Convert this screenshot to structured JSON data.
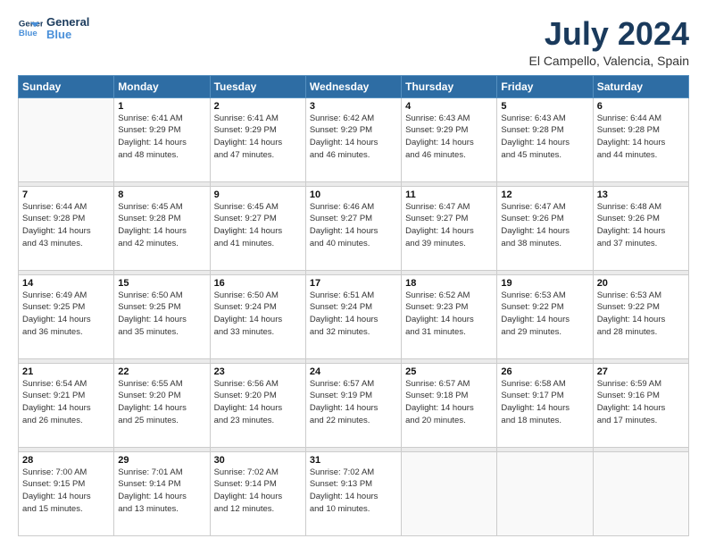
{
  "logo": {
    "line1": "General",
    "line2": "Blue"
  },
  "title": "July 2024",
  "subtitle": "El Campello, Valencia, Spain",
  "days_header": [
    "Sunday",
    "Monday",
    "Tuesday",
    "Wednesday",
    "Thursday",
    "Friday",
    "Saturday"
  ],
  "weeks": [
    [
      {
        "day": "",
        "text": ""
      },
      {
        "day": "1",
        "text": "Sunrise: 6:41 AM\nSunset: 9:29 PM\nDaylight: 14 hours\nand 48 minutes."
      },
      {
        "day": "2",
        "text": "Sunrise: 6:41 AM\nSunset: 9:29 PM\nDaylight: 14 hours\nand 47 minutes."
      },
      {
        "day": "3",
        "text": "Sunrise: 6:42 AM\nSunset: 9:29 PM\nDaylight: 14 hours\nand 46 minutes."
      },
      {
        "day": "4",
        "text": "Sunrise: 6:43 AM\nSunset: 9:29 PM\nDaylight: 14 hours\nand 46 minutes."
      },
      {
        "day": "5",
        "text": "Sunrise: 6:43 AM\nSunset: 9:28 PM\nDaylight: 14 hours\nand 45 minutes."
      },
      {
        "day": "6",
        "text": "Sunrise: 6:44 AM\nSunset: 9:28 PM\nDaylight: 14 hours\nand 44 minutes."
      }
    ],
    [
      {
        "day": "7",
        "text": "Sunrise: 6:44 AM\nSunset: 9:28 PM\nDaylight: 14 hours\nand 43 minutes."
      },
      {
        "day": "8",
        "text": "Sunrise: 6:45 AM\nSunset: 9:28 PM\nDaylight: 14 hours\nand 42 minutes."
      },
      {
        "day": "9",
        "text": "Sunrise: 6:45 AM\nSunset: 9:27 PM\nDaylight: 14 hours\nand 41 minutes."
      },
      {
        "day": "10",
        "text": "Sunrise: 6:46 AM\nSunset: 9:27 PM\nDaylight: 14 hours\nand 40 minutes."
      },
      {
        "day": "11",
        "text": "Sunrise: 6:47 AM\nSunset: 9:27 PM\nDaylight: 14 hours\nand 39 minutes."
      },
      {
        "day": "12",
        "text": "Sunrise: 6:47 AM\nSunset: 9:26 PM\nDaylight: 14 hours\nand 38 minutes."
      },
      {
        "day": "13",
        "text": "Sunrise: 6:48 AM\nSunset: 9:26 PM\nDaylight: 14 hours\nand 37 minutes."
      }
    ],
    [
      {
        "day": "14",
        "text": "Sunrise: 6:49 AM\nSunset: 9:25 PM\nDaylight: 14 hours\nand 36 minutes."
      },
      {
        "day": "15",
        "text": "Sunrise: 6:50 AM\nSunset: 9:25 PM\nDaylight: 14 hours\nand 35 minutes."
      },
      {
        "day": "16",
        "text": "Sunrise: 6:50 AM\nSunset: 9:24 PM\nDaylight: 14 hours\nand 33 minutes."
      },
      {
        "day": "17",
        "text": "Sunrise: 6:51 AM\nSunset: 9:24 PM\nDaylight: 14 hours\nand 32 minutes."
      },
      {
        "day": "18",
        "text": "Sunrise: 6:52 AM\nSunset: 9:23 PM\nDaylight: 14 hours\nand 31 minutes."
      },
      {
        "day": "19",
        "text": "Sunrise: 6:53 AM\nSunset: 9:22 PM\nDaylight: 14 hours\nand 29 minutes."
      },
      {
        "day": "20",
        "text": "Sunrise: 6:53 AM\nSunset: 9:22 PM\nDaylight: 14 hours\nand 28 minutes."
      }
    ],
    [
      {
        "day": "21",
        "text": "Sunrise: 6:54 AM\nSunset: 9:21 PM\nDaylight: 14 hours\nand 26 minutes."
      },
      {
        "day": "22",
        "text": "Sunrise: 6:55 AM\nSunset: 9:20 PM\nDaylight: 14 hours\nand 25 minutes."
      },
      {
        "day": "23",
        "text": "Sunrise: 6:56 AM\nSunset: 9:20 PM\nDaylight: 14 hours\nand 23 minutes."
      },
      {
        "day": "24",
        "text": "Sunrise: 6:57 AM\nSunset: 9:19 PM\nDaylight: 14 hours\nand 22 minutes."
      },
      {
        "day": "25",
        "text": "Sunrise: 6:57 AM\nSunset: 9:18 PM\nDaylight: 14 hours\nand 20 minutes."
      },
      {
        "day": "26",
        "text": "Sunrise: 6:58 AM\nSunset: 9:17 PM\nDaylight: 14 hours\nand 18 minutes."
      },
      {
        "day": "27",
        "text": "Sunrise: 6:59 AM\nSunset: 9:16 PM\nDaylight: 14 hours\nand 17 minutes."
      }
    ],
    [
      {
        "day": "28",
        "text": "Sunrise: 7:00 AM\nSunset: 9:15 PM\nDaylight: 14 hours\nand 15 minutes."
      },
      {
        "day": "29",
        "text": "Sunrise: 7:01 AM\nSunset: 9:14 PM\nDaylight: 14 hours\nand 13 minutes."
      },
      {
        "day": "30",
        "text": "Sunrise: 7:02 AM\nSunset: 9:14 PM\nDaylight: 14 hours\nand 12 minutes."
      },
      {
        "day": "31",
        "text": "Sunrise: 7:02 AM\nSunset: 9:13 PM\nDaylight: 14 hours\nand 10 minutes."
      },
      {
        "day": "",
        "text": ""
      },
      {
        "day": "",
        "text": ""
      },
      {
        "day": "",
        "text": ""
      }
    ]
  ]
}
